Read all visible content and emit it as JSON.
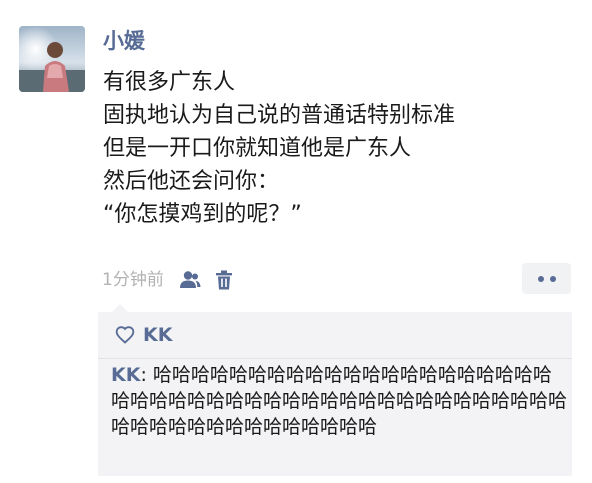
{
  "post": {
    "author": "小媛",
    "lines": [
      "有很多广东人",
      "固执地认为自己说的普通话特别标准",
      "但是一开口你就知道他是广东人",
      "然后他还会问你：",
      "“你怎摸鸡到的呢？”"
    ],
    "time": "1分钟前",
    "icons": {
      "visibility": "people-icon",
      "delete": "trash-icon",
      "more": "more-dots-icon",
      "like": "heart-icon"
    }
  },
  "likes": {
    "names": "KK"
  },
  "comments": [
    {
      "author": "KK",
      "separator": ": ",
      "text": "哈哈哈哈哈哈哈哈哈哈哈哈哈哈哈哈哈哈哈哈哈哈哈哈哈哈哈哈哈哈哈哈哈哈哈哈哈哈哈哈哈哈哈哈哈哈哈哈哈哈哈哈哈哈哈哈哈哈哈"
    }
  ],
  "colors": {
    "link": "#576b95",
    "meta": "#b2b2b2",
    "panel": "#f3f3f5",
    "text": "#1a1a1a"
  }
}
